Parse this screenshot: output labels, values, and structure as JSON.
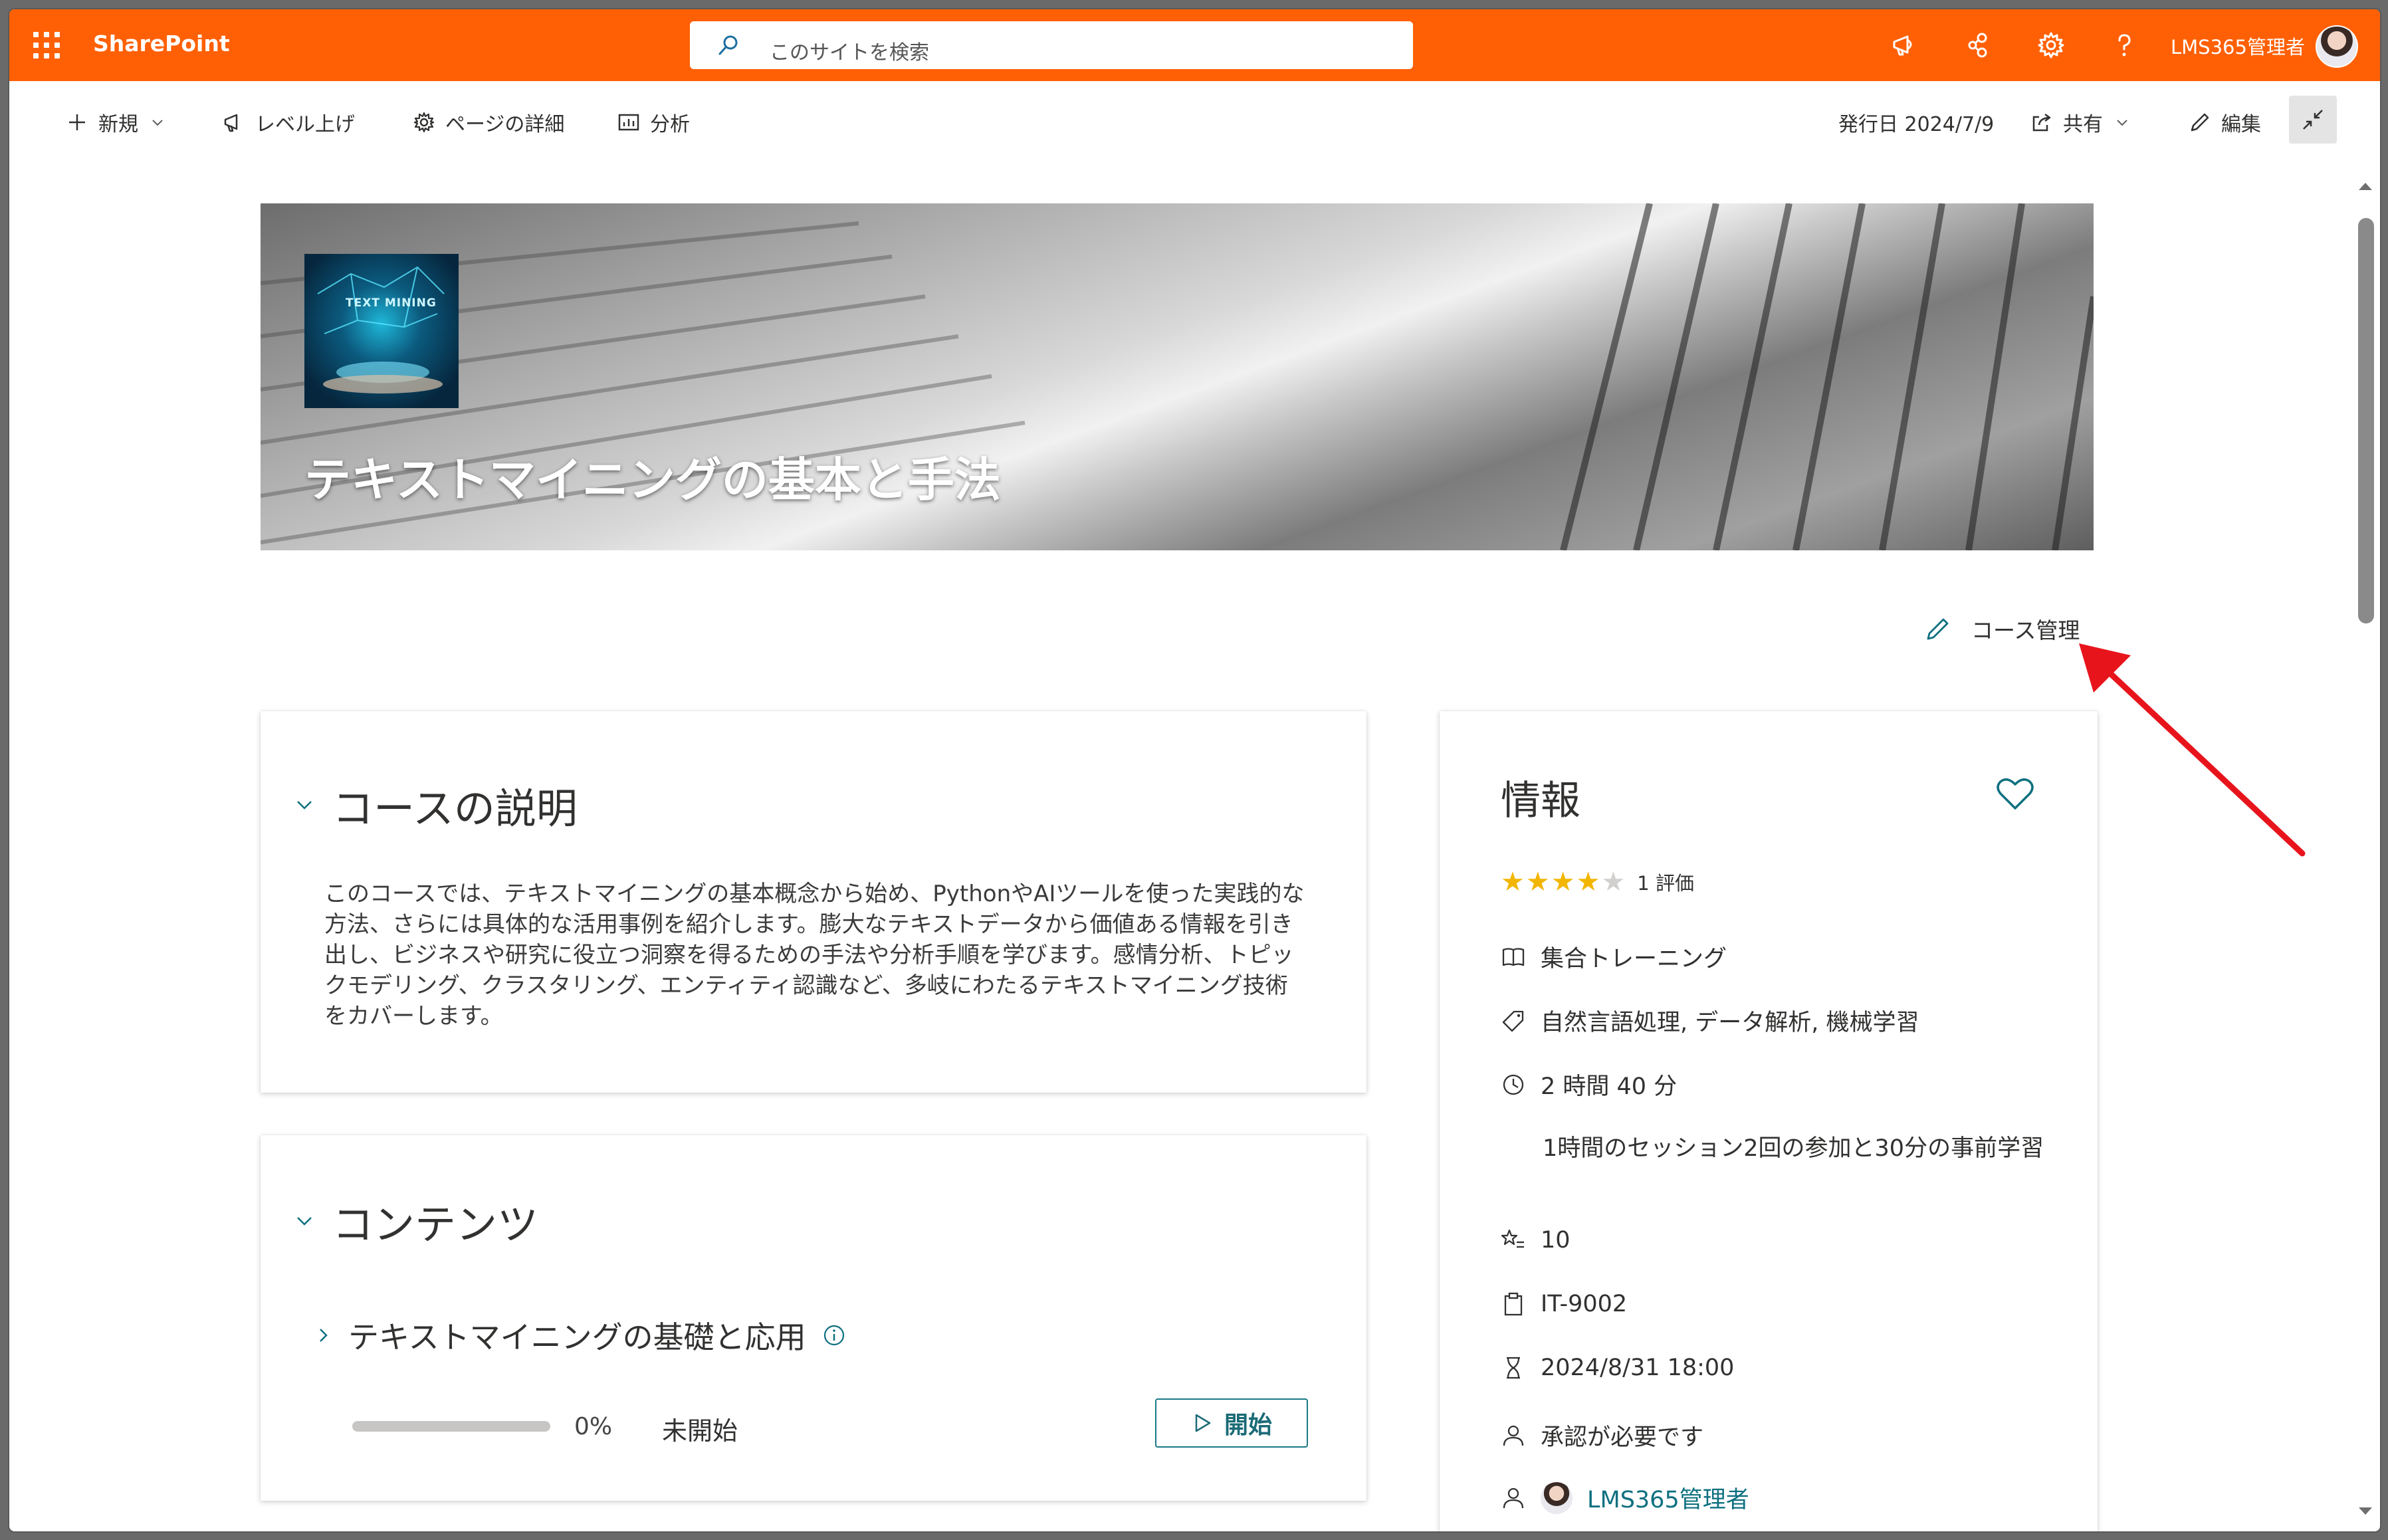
{
  "suite_bar": {
    "brand": "SharePoint",
    "search_placeholder": "このサイトを検索",
    "user_name": "LMS365管理者",
    "accent_color": "#ff6005"
  },
  "command_bar": {
    "new_label": "新規",
    "promote_label": "レベル上げ",
    "page_details_label": "ページの詳細",
    "analytics_label": "分析",
    "published_label": "発行日 2024/7/9",
    "share_label": "共有",
    "edit_label": "編集"
  },
  "hero": {
    "title": "テキストマイニングの基本と手法",
    "thumbnail_text": "TEXT MINING"
  },
  "manage_link": "コース管理",
  "description_section": {
    "heading": "コースの説明",
    "text": "このコースでは、テキストマイニングの基本概念から始め、PythonやAIツールを使った実践的な方法、さらには具体的な活用事例を紹介します。膨大なテキストデータから価値ある情報を引き出し、ビジネスや研究に役立つ洞察を得るための手法や分析手順を学びます。感情分析、トピックモデリング、クラスタリング、エンティティ認識など、多岐にわたるテキストマイニング技術をカバーします。"
  },
  "contents_section": {
    "heading": "コンテンツ",
    "module": {
      "title": "テキストマイニングの基礎と応用",
      "progress": 0,
      "progress_label": "0%",
      "status": "未開始",
      "start_label": "開始"
    }
  },
  "info_panel": {
    "title": "情報",
    "rating": 4,
    "rating_max": 5,
    "rating_text": "1 評価",
    "training_type": "集合トレーニング",
    "tags": "自然言語処理, データ解析, 機械学習",
    "duration": "2 時間 40 分",
    "duration_note": "1時間のセッション2回の参加と30分の事前学習",
    "points": "10",
    "course_code": "IT-9002",
    "deadline": "2024/8/31 18:00",
    "approval": "承認が必要です",
    "author": "LMS365管理者"
  }
}
